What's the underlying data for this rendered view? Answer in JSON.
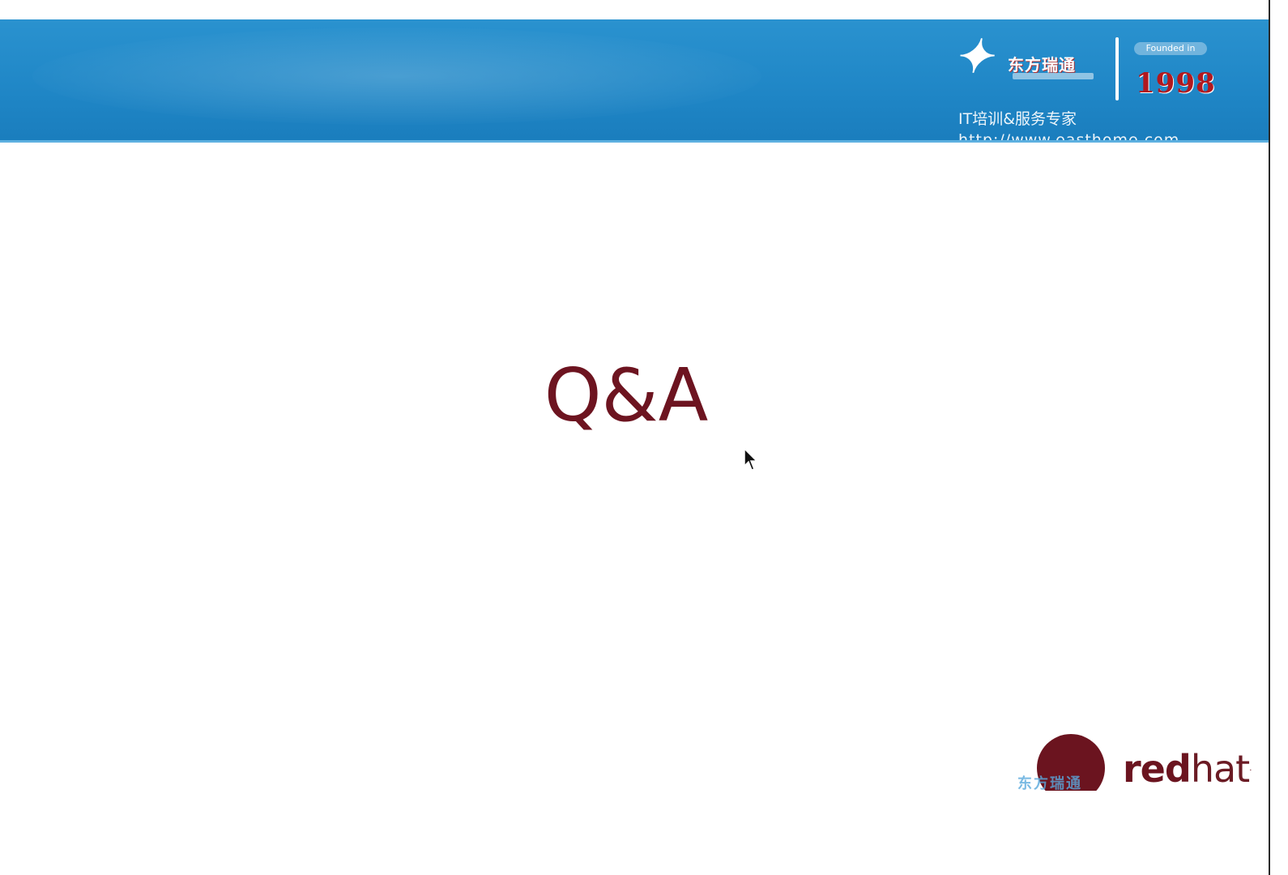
{
  "banner": {
    "brand_name": "东方瑞通",
    "founded_label": "Founded in",
    "year": "1998",
    "tagline": "IT培训&服务专家",
    "website": "http://www.easthome.com"
  },
  "slide": {
    "title": "Q&A"
  },
  "footer_logo": {
    "red": "red",
    "hat": "hat",
    "tm": ".",
    "watermark": "东方瑞通"
  },
  "colors": {
    "banner_blue": "#1f86c6",
    "title_maroon": "#6d1420",
    "year_red": "#b1191f",
    "redhat_maroon": "#6b141f"
  },
  "icons": {
    "cursor": "mouse-pointer-icon",
    "logo": "easthome-logo-icon",
    "redhat_mark": "redhat-logo-icon"
  }
}
